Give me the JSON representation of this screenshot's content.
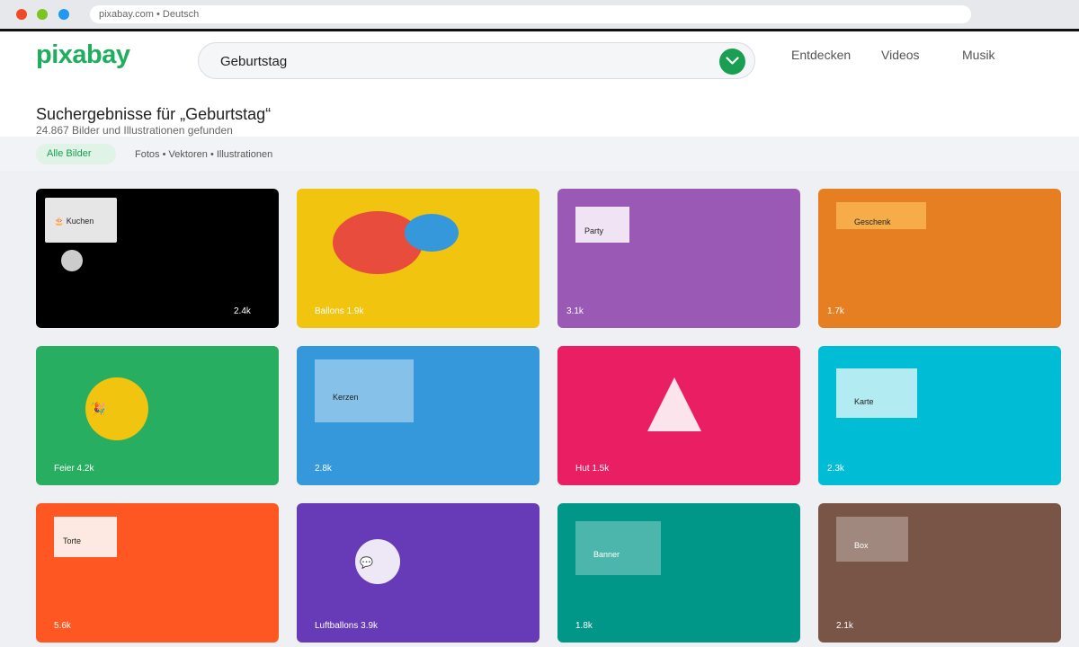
{
  "browser": {
    "url": "pixabay.com • Deutsch"
  },
  "header": {
    "logo": "pixabay",
    "search_value": "Geburtstag",
    "nav": [
      "Entdecken",
      "Videos",
      "Musik"
    ]
  },
  "results": {
    "title": "Suchergebnisse für „Geburtstag“",
    "count": "24.867 Bilder und Illustrationen gefunden",
    "filter_active": "Alle Bilder",
    "filter_types": "Fotos • Vektoren • Illustrationen"
  },
  "colors": {
    "brand": "#1fae5e",
    "cards": [
      "#000000",
      "#f1c40f",
      "#9b59b6",
      "#e67e22",
      "#27ae60",
      "#3498db",
      "#e91e63",
      "#00bcd4",
      "#ff5722",
      "#673ab7",
      "#009688",
      "#795548"
    ]
  },
  "cards": [
    {
      "inner_text": "🎂 Kuchen",
      "caption": "2.4k"
    },
    {
      "inner_text": "",
      "caption": "Ballons 1.9k"
    },
    {
      "inner_text": "Party",
      "caption": "3.1k"
    },
    {
      "inner_text": "Geschenk",
      "caption": "1.7k"
    },
    {
      "inner_text": "🎉",
      "caption": "Feier 4.2k"
    },
    {
      "inner_text": "Kerzen",
      "caption": "2.8k"
    },
    {
      "inner_text": "",
      "caption": "Hut 1.5k"
    },
    {
      "inner_text": "Karte",
      "caption": "2.3k"
    },
    {
      "inner_text": "Torte",
      "caption": "5.6k"
    },
    {
      "inner_text": "💬",
      "caption": "Luftballons 3.9k"
    },
    {
      "inner_text": "Banner",
      "caption": "1.8k"
    },
    {
      "inner_text": "Box",
      "caption": "2.1k"
    }
  ]
}
